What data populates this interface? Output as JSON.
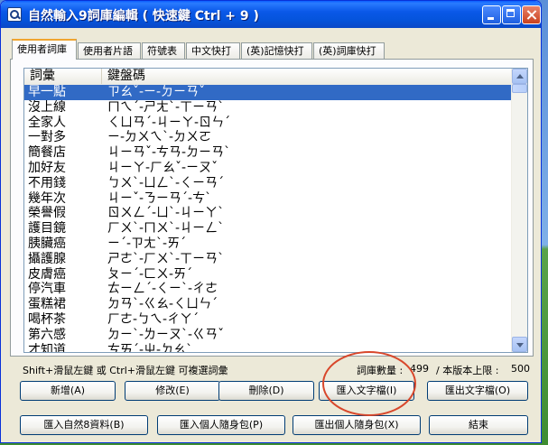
{
  "window": {
    "title": "自然輸入9詞庫編輯 ( 快速鍵 Ctrl + 9 )"
  },
  "tabs": [
    {
      "label": "使用者詞庫",
      "active": true
    },
    {
      "label": "使用者片語",
      "active": false
    },
    {
      "label": "符號表",
      "active": false
    },
    {
      "label": "中文快打",
      "active": false
    },
    {
      "label": "(英)記憶快打",
      "active": false
    },
    {
      "label": "(英)詞庫快打",
      "active": false
    }
  ],
  "list": {
    "columns": [
      "詞彙",
      "鍵盤碼"
    ],
    "rows": [
      {
        "word": "早一點",
        "code": "ㄗㄠˇ-ㄧ-ㄉㄧㄢˇ",
        "selected": true
      },
      {
        "word": "沒上線",
        "code": "ㄇㄟˊ-ㄕㄤˋ-ㄒㄧㄢˋ"
      },
      {
        "word": "全家人",
        "code": "ㄑㄩㄢˊ-ㄐㄧㄚ-ㄖㄣˊ"
      },
      {
        "word": "一對多",
        "code": "ㄧ-ㄉㄨㄟˋ-ㄉㄨㄛ"
      },
      {
        "word": "簡餐店",
        "code": "ㄐㄧㄢˇ-ㄘㄢ-ㄉㄧㄢˋ"
      },
      {
        "word": "加好友",
        "code": "ㄐㄧㄚ-ㄏㄠˇ-ㄧㄡˇ"
      },
      {
        "word": "不用錢",
        "code": "ㄅㄨˋ-ㄩㄥˋ-ㄑㄧㄢˊ"
      },
      {
        "word": "幾年次",
        "code": "ㄐㄧˇ-ㄋㄧㄢˊ-ㄘˋ"
      },
      {
        "word": "榮譽假",
        "code": "ㄖㄨㄥˊ-ㄩˋ-ㄐㄧㄚˋ"
      },
      {
        "word": "護目鏡",
        "code": "ㄏㄨˋ-ㄇㄨˋ-ㄐㄧㄥˋ"
      },
      {
        "word": "胰臟癌",
        "code": "ㄧˊ-ㄗㄤˋ-ㄞˊ"
      },
      {
        "word": "攝護腺",
        "code": "ㄕㄜˋ-ㄏㄨˋ-ㄒㄧㄢˋ"
      },
      {
        "word": "皮膚癌",
        "code": "ㄆㄧˊ-ㄈㄨ-ㄞˊ"
      },
      {
        "word": "停汽車",
        "code": "ㄊㄧㄥˊ-ㄑㄧˋ-ㄔㄜ"
      },
      {
        "word": "蛋糕裙",
        "code": "ㄉㄢˋ-ㄍㄠ-ㄑㄩㄣˊ"
      },
      {
        "word": "喝杯茶",
        "code": "ㄏㄜ-ㄅㄟ-ㄔㄚˊ"
      },
      {
        "word": "第六感",
        "code": "ㄉㄧˋ-ㄌㄧㄡˋ-ㄍㄢˇ"
      },
      {
        "word": "才知道",
        "code": "ㄘㄞˊ-ㄓ-ㄉㄠˋ"
      }
    ]
  },
  "status": {
    "hint": "Shift+滑鼠左鍵 或 Ctrl+滑鼠左鍵 可複選詞彙",
    "count_label": "詞庫數量 :",
    "count_value": "499",
    "limit_label": "/ 本版本上限 :",
    "limit_value": "500"
  },
  "buttons_row1": [
    "新增(A)",
    "修改(E)",
    "刪除(D)",
    "匯入文字檔(I)",
    "匯出文字檔(O)"
  ],
  "buttons_row2": [
    "匯入自然8資料(B)",
    "匯入個人隨身包(P)",
    "匯出個人隨身包(X)",
    "結束"
  ],
  "colors": {
    "titlebar": "#0554dc",
    "selection": "#316ac5",
    "annotation": "#d8472b",
    "active_tab_accent": "#f0a530"
  }
}
